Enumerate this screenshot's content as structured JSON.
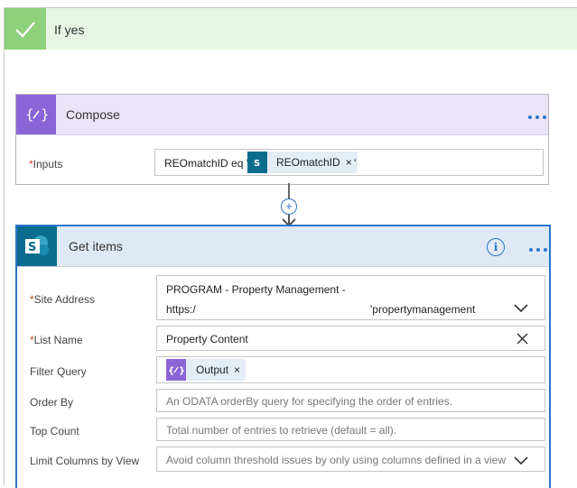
{
  "condition": {
    "title": "If yes",
    "accent_color": "#8fd07c",
    "header_bg": "#e8f5e3",
    "icon": "check-icon"
  },
  "compose": {
    "title": "Compose",
    "icon": "curly-braces-icon",
    "accent_color": "#8b64d8",
    "more": "...",
    "inputs_label": "Inputs",
    "inputs_required": "*",
    "inputs_prefix": "REOmatchID eq '",
    "token_label": "REOmatchID",
    "token_icon": "sharepoint-icon",
    "token_remove": "×",
    "inputs_suffix": "'"
  },
  "connector": {
    "add_label": "+"
  },
  "get_items": {
    "title": "Get items",
    "icon": "sharepoint-icon",
    "accent_color": "#2b75c9",
    "info": "i",
    "more": "...",
    "fields": {
      "site_address": {
        "label": "Site Address",
        "required": "*",
        "value_line1": "PROGRAM - Property Management -",
        "value_line2_prefix": "https:/",
        "value_line2_suffix": "'propertymanagement"
      },
      "list_name": {
        "label": "List Name",
        "required": "*",
        "value": "Property Content",
        "clear": "×"
      },
      "filter_query": {
        "label": "Filter Query",
        "token_label": "Output",
        "token_icon": "curly-braces-icon",
        "token_remove": "×"
      },
      "order_by": {
        "label": "Order By",
        "placeholder": "An ODATA orderBy query for specifying the order of entries."
      },
      "top_count": {
        "label": "Top Count",
        "placeholder": "Total number of entries to retrieve (default = all)."
      },
      "limit_columns": {
        "label": "Limit Columns by View",
        "placeholder": "Avoid column threshold issues by only using columns defined in a view"
      }
    }
  }
}
